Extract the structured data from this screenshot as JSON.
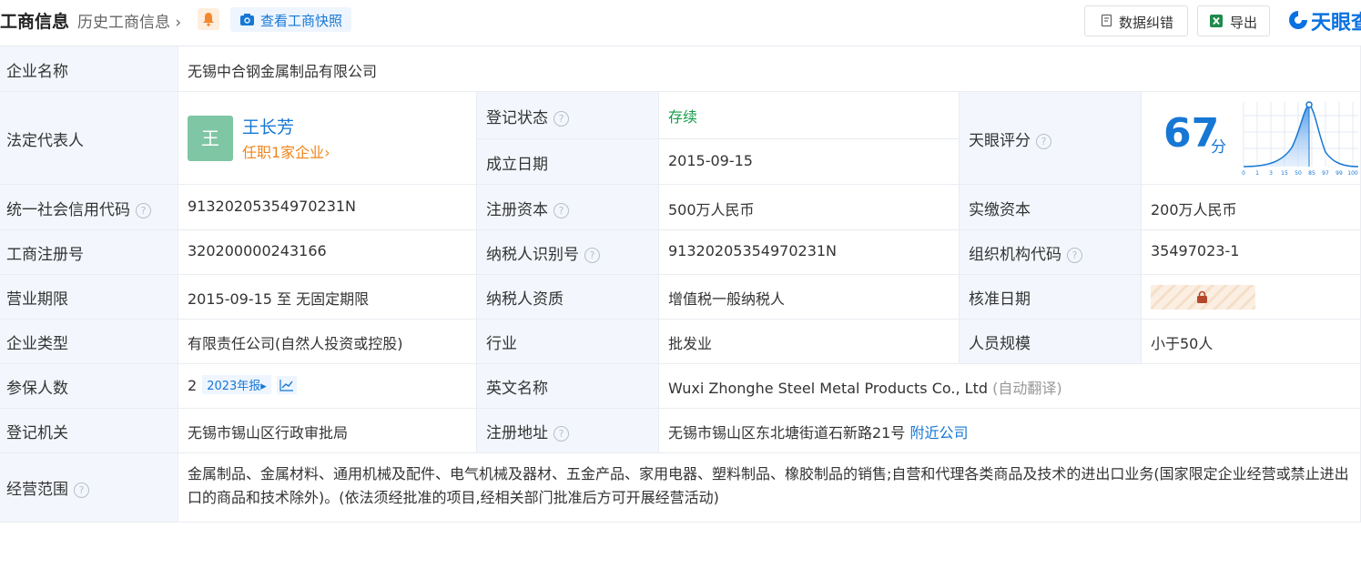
{
  "header": {
    "title": "工商信息",
    "history_label": "历史工商信息",
    "snapshot_label": "查看工商快照",
    "correct_label": "数据纠错",
    "export_label": "导出",
    "brand": "天眼查"
  },
  "fields": {
    "company_name_label": "企业名称",
    "company_name": "无锡中合钢金属制品有限公司",
    "legal_rep_label": "法定代表人",
    "legal_rep_avatar": "王",
    "legal_rep_name": "王长芳",
    "legal_rep_sub": "任职1家企业",
    "reg_status_label": "登记状态",
    "reg_status": "存续",
    "est_date_label": "成立日期",
    "est_date": "2015-09-15",
    "score_label": "天眼评分",
    "score": "67",
    "score_unit": "分",
    "credit_code_label": "统一社会信用代码",
    "credit_code": "91320205354970231N",
    "reg_capital_label": "注册资本",
    "reg_capital": "500万人民币",
    "paid_capital_label": "实缴资本",
    "paid_capital": "200万人民币",
    "reg_no_label": "工商注册号",
    "reg_no": "320200000243166",
    "taxpayer_id_label": "纳税人识别号",
    "taxpayer_id": "91320205354970231N",
    "org_code_label": "组织机构代码",
    "org_code": "35497023-1",
    "term_label": "营业期限",
    "term": "2015-09-15 至 无固定期限",
    "taxpayer_qual_label": "纳税人资质",
    "taxpayer_qual": "增值税一般纳税人",
    "approve_date_label": "核准日期",
    "type_label": "企业类型",
    "type": "有限责任公司(自然人投资或控股)",
    "industry_label": "行业",
    "industry": "批发业",
    "staff_label": "人员规模",
    "staff": "小于50人",
    "insured_label": "参保人数",
    "insured": "2",
    "insured_year": "2023年报",
    "en_name_label": "英文名称",
    "en_name": "Wuxi Zhonghe Steel Metal Products Co., Ltd",
    "en_name_note": "(自动翻译)",
    "authority_label": "登记机关",
    "authority": "无锡市锡山区行政审批局",
    "address_label": "注册地址",
    "address": "无锡市锡山区东北塘街道石新路21号",
    "nearby_label": "附近公司",
    "scope_label": "经营范围",
    "scope": "金属制品、金属材料、通用机械及配件、电气机械及器材、五金产品、家用电器、塑料制品、橡胶制品的销售;自营和代理各类商品及技术的进出口业务(国家限定企业经营或禁止进出口的商品和技术除外)。(依法须经批准的项目,经相关部门批准后方可开展经营活动)"
  },
  "score_chart": {
    "x_ticks": [
      "0",
      "1",
      "3",
      "15",
      "50",
      "85",
      "97",
      "99",
      "100"
    ]
  },
  "colors": {
    "accent": "#1677d4",
    "status_green": "#159c4a",
    "label_bg": "#f3f7fd",
    "orange": "#f08519"
  },
  "icons": [
    "bell-icon",
    "camera-icon",
    "edit-icon",
    "excel-icon",
    "help-icon",
    "lock-icon",
    "trend-icon",
    "chevron-right-icon"
  ]
}
